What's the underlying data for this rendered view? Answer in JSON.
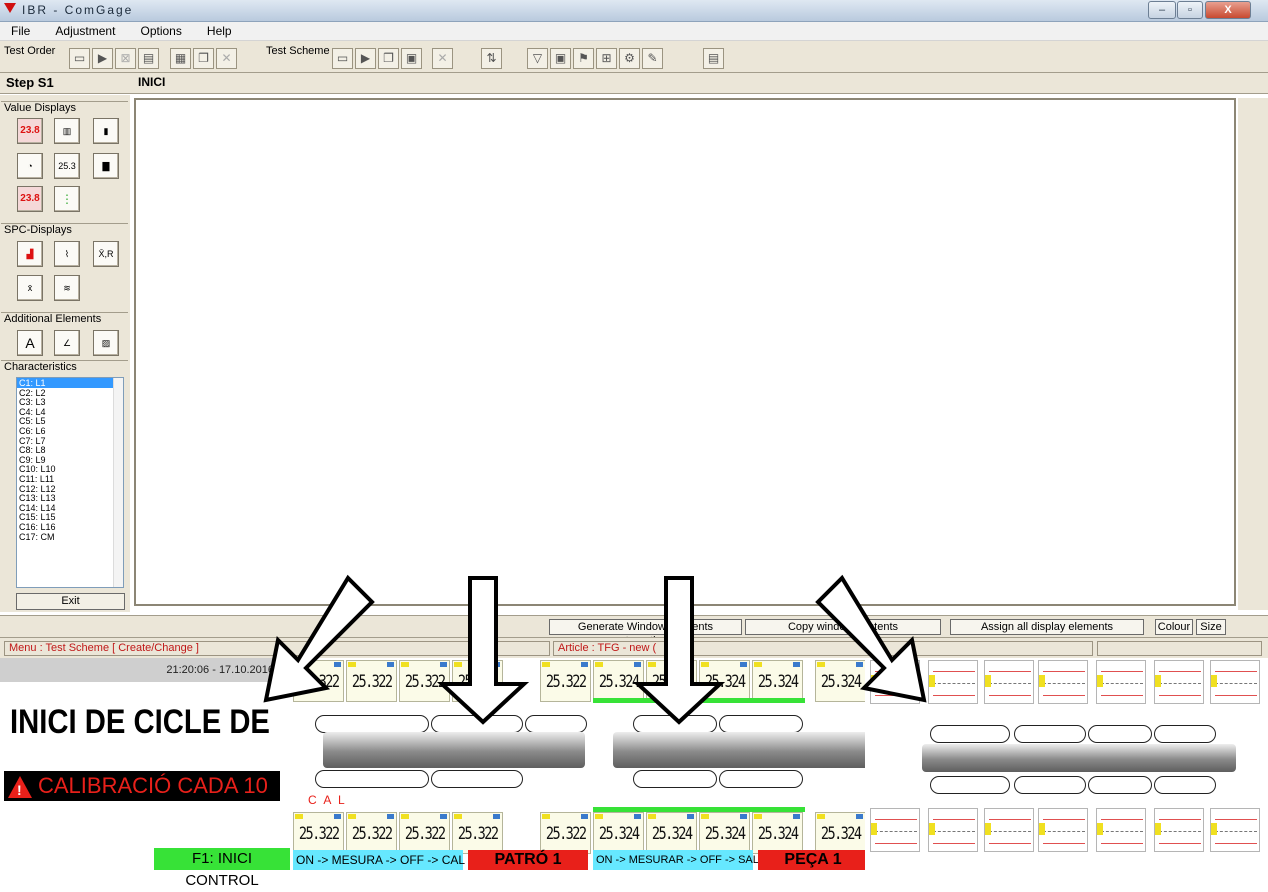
{
  "window": {
    "title": "IBR - ComGage",
    "buttons": [
      "–",
      "▫",
      "X"
    ]
  },
  "menu": [
    "File",
    "Adjustment",
    "Options",
    "Help"
  ],
  "toolbar": {
    "test_order_label": "Test Order",
    "test_scheme_label": "Test Scheme"
  },
  "step": {
    "label": "Step S1",
    "name": "INICI"
  },
  "palette": {
    "value_displays": "Value Displays",
    "spc_displays": "SPC-Displays",
    "additional_elements": "Additional Elements",
    "characteristics": "Characteristics",
    "characteristics_list": [
      "C1: L1",
      "C2: L2",
      "C3: L3",
      "C4: L4",
      "C5: L5",
      "C6: L6",
      "C7: L7",
      "C8: L8",
      "C9: L9",
      "C10: L10",
      "C11: L11",
      "C12: L12",
      "C13: L13",
      "C14: L14",
      "C15: L15",
      "C16: L16",
      "C17: CM"
    ],
    "icons": {
      "lcd1": "23.8",
      "lcd2": "25.3",
      "lcd3": "23.8",
      "spc": "X̄,R"
    },
    "exit": "Exit"
  },
  "bottom_buttons": {
    "generate": "Generate Window Contents automatically",
    "copy": "Copy window contents",
    "assign": "Assign all display elements",
    "colour": "Colour",
    "size": "Size"
  },
  "status": {
    "menu": "Menu :  Test Scheme  [ Create/Change ]",
    "article": "Article :  TFG - new  ("
  },
  "panel_a": {
    "clock": "21:20:06  -  17.10.2016",
    "big_text": "INICI DE CICLE DE",
    "warning": "CALIBRACIÓ CADA 10",
    "f1": "F1: INICI CONTROL"
  },
  "panel_b": {
    "value": "25.322",
    "cal": "C  A  L",
    "mode": "ON -> MESURA -> OFF -> CAL",
    "badge": "PATRÓ 1"
  },
  "panel_c": {
    "value": "25.324",
    "mode": "ON -> MESURAR -> OFF -> SALVAR",
    "badge": "PEÇA 1"
  },
  "colors": {
    "accent_red": "#d11",
    "panel_green": "#37e237",
    "legend_cyan": "#66e8ff",
    "badge_red": "#e8201a"
  }
}
